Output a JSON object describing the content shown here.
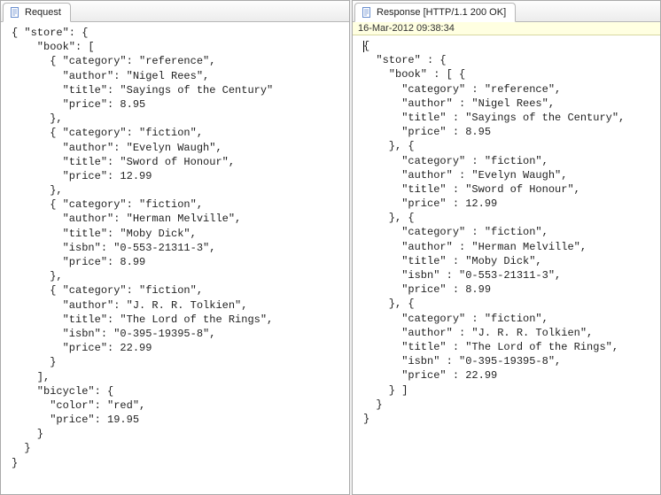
{
  "left": {
    "tab_label": "Request",
    "code_lines": [
      "{ \"store\": {",
      "    \"book\": [ ",
      "      { \"category\": \"reference\",",
      "        \"author\": \"Nigel Rees\",",
      "        \"title\": \"Sayings of the Century\"",
      "        \"price\": 8.95",
      "      },",
      "      { \"category\": \"fiction\",",
      "        \"author\": \"Evelyn Waugh\",",
      "        \"title\": \"Sword of Honour\",",
      "        \"price\": 12.99",
      "      },",
      "      { \"category\": \"fiction\",",
      "        \"author\": \"Herman Melville\",",
      "        \"title\": \"Moby Dick\",",
      "        \"isbn\": \"0-553-21311-3\",",
      "        \"price\": 8.99",
      "      },",
      "      { \"category\": \"fiction\",",
      "        \"author\": \"J. R. R. Tolkien\",",
      "        \"title\": \"The Lord of the Rings\",",
      "        \"isbn\": \"0-395-19395-8\",",
      "        \"price\": 22.99",
      "      }",
      "    ],",
      "    \"bicycle\": {",
      "      \"color\": \"red\",",
      "      \"price\": 19.95",
      "    }",
      "  }",
      "}"
    ]
  },
  "right": {
    "tab_label": "Response [HTTP/1.1 200 OK]",
    "timestamp": "16-Mar-2012 09:38:34",
    "code_lines": [
      "{",
      "  \"store\" : {",
      "    \"book\" : [ {",
      "      \"category\" : \"reference\",",
      "      \"author\" : \"Nigel Rees\",",
      "      \"title\" : \"Sayings of the Century\",",
      "      \"price\" : 8.95",
      "    }, {",
      "      \"category\" : \"fiction\",",
      "      \"author\" : \"Evelyn Waugh\",",
      "      \"title\" : \"Sword of Honour\",",
      "      \"price\" : 12.99",
      "    }, {",
      "      \"category\" : \"fiction\",",
      "      \"author\" : \"Herman Melville\",",
      "      \"title\" : \"Moby Dick\",",
      "      \"isbn\" : \"0-553-21311-3\",",
      "      \"price\" : 8.99",
      "    }, {",
      "      \"category\" : \"fiction\",",
      "      \"author\" : \"J. R. R. Tolkien\",",
      "      \"title\" : \"The Lord of the Rings\",",
      "      \"isbn\" : \"0-395-19395-8\",",
      "      \"price\" : 22.99",
      "    } ]",
      "  }",
      "}"
    ]
  }
}
